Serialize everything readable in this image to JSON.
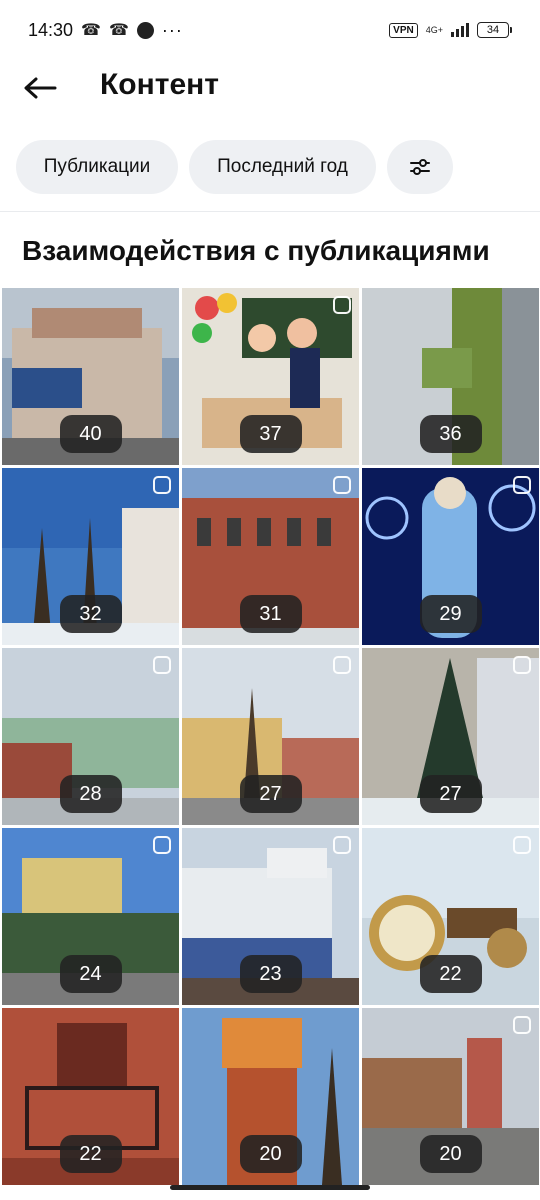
{
  "status_bar": {
    "time": "14:30",
    "vpn": "VPN",
    "network": "4G+",
    "battery": "34"
  },
  "header": {
    "back_icon": "arrow-left-icon",
    "title": "Контент"
  },
  "filters": {
    "publications": "Публикации",
    "period": "Последний год",
    "settings_icon": "sliders-icon"
  },
  "section_title": "Взаимодействия с публикациями",
  "posts": [
    {
      "count": "40",
      "has_icon": false
    },
    {
      "count": "37",
      "has_icon": true
    },
    {
      "count": "36",
      "has_icon": false
    },
    {
      "count": "32",
      "has_icon": true
    },
    {
      "count": "31",
      "has_icon": true
    },
    {
      "count": "29",
      "has_icon": true
    },
    {
      "count": "28",
      "has_icon": true
    },
    {
      "count": "27",
      "has_icon": true
    },
    {
      "count": "27",
      "has_icon": true
    },
    {
      "count": "24",
      "has_icon": true
    },
    {
      "count": "23",
      "has_icon": true
    },
    {
      "count": "22",
      "has_icon": true
    },
    {
      "count": "22",
      "has_icon": false
    },
    {
      "count": "20",
      "has_icon": false
    },
    {
      "count": "20",
      "has_icon": true
    }
  ]
}
